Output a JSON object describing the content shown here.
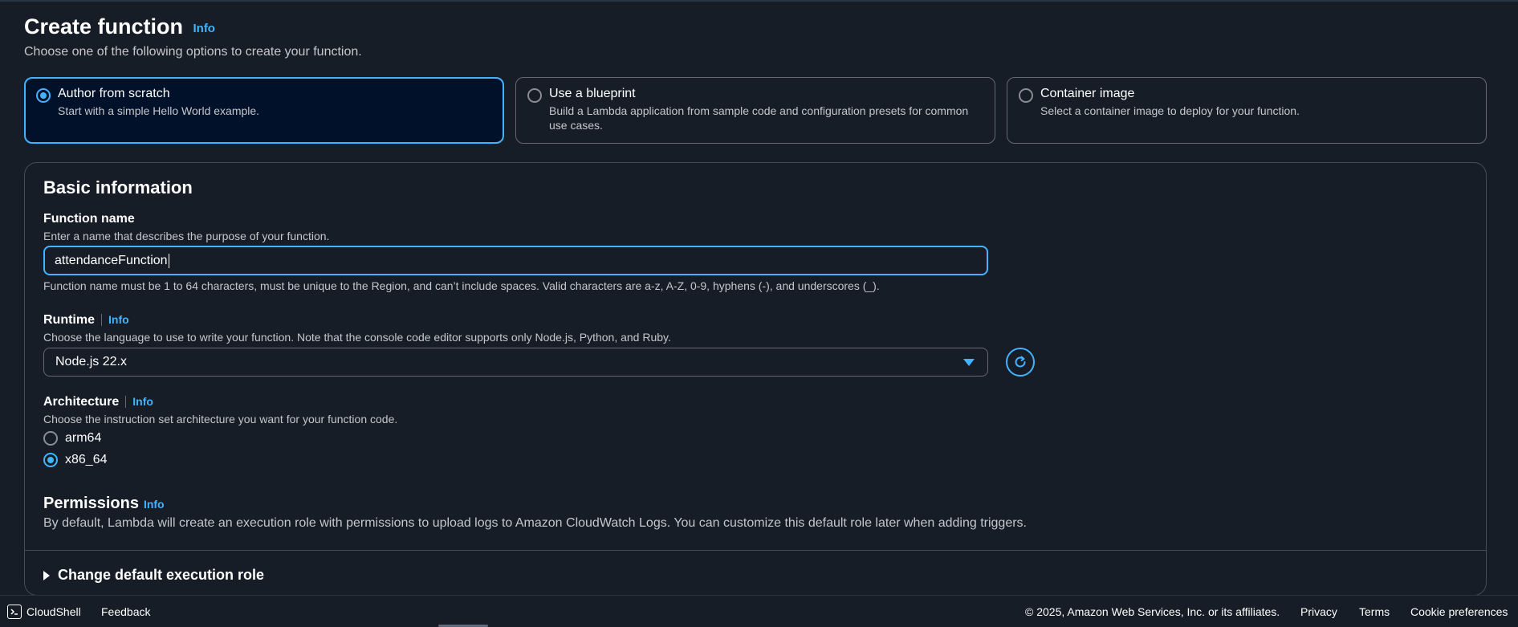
{
  "header": {
    "title": "Create function",
    "info": "Info",
    "description": "Choose one of the following options to create your function."
  },
  "options": [
    {
      "title": "Author from scratch",
      "description": "Start with a simple Hello World example.",
      "selected": true
    },
    {
      "title": "Use a blueprint",
      "description": "Build a Lambda application from sample code and configuration presets for common use cases.",
      "selected": false
    },
    {
      "title": "Container image",
      "description": "Select a container image to deploy for your function.",
      "selected": false
    }
  ],
  "basic": {
    "title": "Basic information",
    "function_name": {
      "label": "Function name",
      "description": "Enter a name that describes the purpose of your function.",
      "value": "attendanceFunction",
      "constraint": "Function name must be 1 to 64 characters, must be unique to the Region, and can’t include spaces. Valid characters are a-z, A-Z, 0-9, hyphens (-), and underscores (_)."
    },
    "runtime": {
      "label": "Runtime",
      "info": "Info",
      "description": "Choose the language to use to write your function. Note that the console code editor supports only Node.js, Python, and Ruby.",
      "selected": "Node.js 22.x"
    },
    "architecture": {
      "label": "Architecture",
      "info": "Info",
      "description": "Choose the instruction set architecture you want for your function code.",
      "options": [
        "arm64",
        "x86_64"
      ],
      "selected": "x86_64"
    },
    "permissions": {
      "title": "Permissions",
      "info": "Info",
      "description": "By default, Lambda will create an execution role with permissions to upload logs to Amazon CloudWatch Logs. You can customize this default role later when adding triggers."
    },
    "expander": "Change default execution role"
  },
  "footer": {
    "cloudshell": "CloudShell",
    "feedback": "Feedback",
    "copyright": "© 2025, Amazon Web Services, Inc. or its affiliates.",
    "privacy": "Privacy",
    "terms": "Terms",
    "cookie": "Cookie preferences"
  },
  "colors": {
    "accent": "#42b4ff",
    "background": "#161d26",
    "selected_card_bg": "#001129"
  }
}
